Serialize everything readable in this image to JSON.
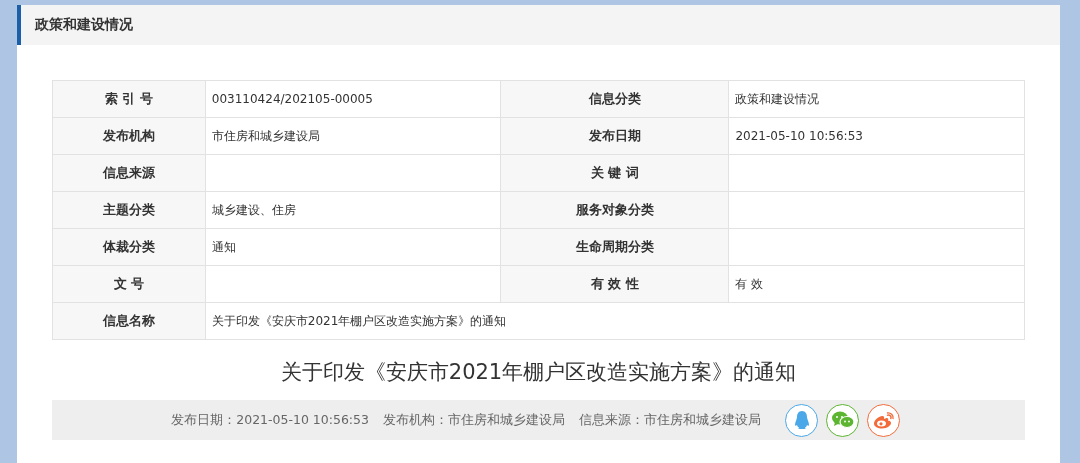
{
  "section": {
    "title": "政策和建设情况"
  },
  "info_table": {
    "rows": [
      [
        {
          "label": "索 引 号",
          "value": "003110424/202105-00005"
        },
        {
          "label": "信息分类",
          "value": "政策和建设情况"
        }
      ],
      [
        {
          "label": "发布机构",
          "value": "市住房和城乡建设局"
        },
        {
          "label": "发布日期",
          "value": "2021-05-10 10:56:53"
        }
      ],
      [
        {
          "label": "信息来源"
        },
        {
          "label": "关 键 词"
        }
      ],
      [
        {
          "label": "主题分类",
          "value": "城乡建设、住房"
        },
        {
          "label": "服务对象分类"
        }
      ],
      [
        {
          "label": "体裁分类",
          "value": "通知"
        },
        {
          "label": "生命周期分类"
        }
      ],
      [
        {
          "label": "文 号"
        },
        {
          "label": "有 效 性",
          "value": "有 效"
        }
      ],
      [
        {
          "label": "信息名称",
          "value": "关于印发《安庆市2021年棚户区改造实施方案》的通知"
        }
      ]
    ]
  },
  "article": {
    "title": "关于印发《安庆市2021年棚户区改造实施方案》的通知"
  },
  "meta_bar": {
    "items": [
      "发布日期：2021-05-10 10:56:53",
      "发布机构：市住房和城乡建设局",
      "信息来源：市住房和城乡建设局"
    ],
    "share": [
      {
        "kind": "penguin",
        "color": "#4aa8e8"
      },
      {
        "kind": "chat",
        "color": "#5cb531"
      },
      {
        "kind": "eye",
        "color": "#f26c3b"
      }
    ]
  }
}
